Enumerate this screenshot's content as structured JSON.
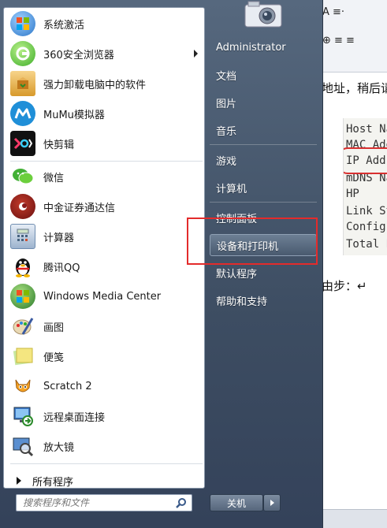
{
  "document": {
    "line1": "地址，稍后请",
    "line2": "由步：↵",
    "terminal_lines": [
      "Host Na",
      "MAC Add",
      "IP Addr",
      "mDNS Na",
      "   HP",
      "Link St",
      "Config",
      "Total P"
    ],
    "ribbon": {
      "row1": "A  ≡·",
      "row2": "⊕  ≡  ≡"
    }
  },
  "start_menu": {
    "programs": [
      {
        "label": "系统激活",
        "icon": "windows-activation-icon",
        "color": "#2b76c8"
      },
      {
        "label": "360安全浏览器",
        "icon": "browser-360-icon",
        "color": "#3fae2a",
        "has_submenu": true
      },
      {
        "label": "强力卸载电脑中的软件",
        "icon": "uninstall-box-icon",
        "color": "#d89a2c"
      },
      {
        "label": "MuMu模拟器",
        "icon": "mumu-icon",
        "color": "#1f8fd8"
      },
      {
        "label": "快剪辑",
        "icon": "kuaijianji-icon",
        "color": "#111111"
      },
      {
        "label": "微信",
        "icon": "wechat-icon",
        "color": "#42b035"
      },
      {
        "label": "中金证券通达信",
        "icon": "tongdaxin-icon",
        "color": "#8a1a1a"
      },
      {
        "label": "计算器",
        "icon": "calculator-icon",
        "color": "#6f8db0"
      },
      {
        "label": "腾讯QQ",
        "icon": "qq-penguin-icon",
        "color": "#111111"
      },
      {
        "label": "Windows Media Center",
        "icon": "media-center-icon",
        "color": "#3c8d2f"
      },
      {
        "label": "画图",
        "icon": "paint-icon",
        "color": "#4b8fd3"
      },
      {
        "label": "便笺",
        "icon": "sticky-notes-icon",
        "color": "#e8d86a"
      },
      {
        "label": "Scratch 2",
        "icon": "scratch-cat-icon",
        "color": "#f0a020"
      },
      {
        "label": "远程桌面连接",
        "icon": "remote-desktop-icon",
        "color": "#3a78c8"
      },
      {
        "label": "放大镜",
        "icon": "magnifier-icon",
        "color": "#5a8fd0"
      }
    ],
    "all_programs": "所有程序",
    "search": {
      "placeholder": "搜索程序和文件"
    },
    "right_items": [
      {
        "label": "Administrator"
      },
      {
        "label": "文档"
      },
      {
        "label": "图片"
      },
      {
        "label": "音乐"
      },
      {
        "label": "游戏"
      },
      {
        "label": "计算机"
      },
      {
        "label": "控制面板"
      },
      {
        "label": "设备和打印机"
      },
      {
        "label": "默认程序"
      },
      {
        "label": "帮助和支持"
      }
    ],
    "shutdown_label": "关机"
  }
}
